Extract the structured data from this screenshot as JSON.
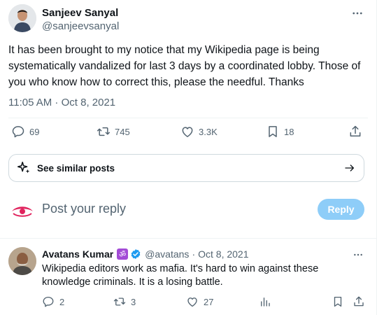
{
  "tweet": {
    "author_name": "Sanjeev Sanyal",
    "author_handle": "@sanjeevsanyal",
    "text": "It has been brought to my notice that my Wikipedia page is being systematically vandalized for last 3 days by a coordinated lobby. Those of you who know how to correct this, please the needful. Thanks",
    "timestamp": "11:05 AM · Oct 8, 2021",
    "actions": {
      "replies": "69",
      "retweets": "745",
      "likes": "3.3K",
      "bookmarks": "18"
    }
  },
  "similar_posts": {
    "label": "See similar posts"
  },
  "compose_reply": {
    "placeholder": "Post your reply",
    "button_label": "Reply"
  },
  "reply_tweet": {
    "author_name": "Avatans Kumar",
    "badge": "ॐ",
    "author_handle": "@avatans",
    "separator": "·",
    "date": "Oct 8, 2021",
    "text": "Wikipedia editors work as mafia. It's hard to win against these knowledge criminals. It is a losing battle.",
    "actions": {
      "replies": "2",
      "retweets": "3",
      "likes": "27"
    }
  },
  "colors": {
    "text_primary": "#0f1419",
    "text_secondary": "#536471",
    "reply_button_disabled": "#8ecdf8",
    "verified_blue": "#1d9bf0",
    "border": "#eff3f4"
  },
  "icons": [
    "more-icon",
    "reply-icon",
    "retweet-icon",
    "like-icon",
    "bookmark-icon",
    "share-icon",
    "sparkle-icon",
    "arrow-right-icon",
    "analytics-icon",
    "verified-icon"
  ]
}
